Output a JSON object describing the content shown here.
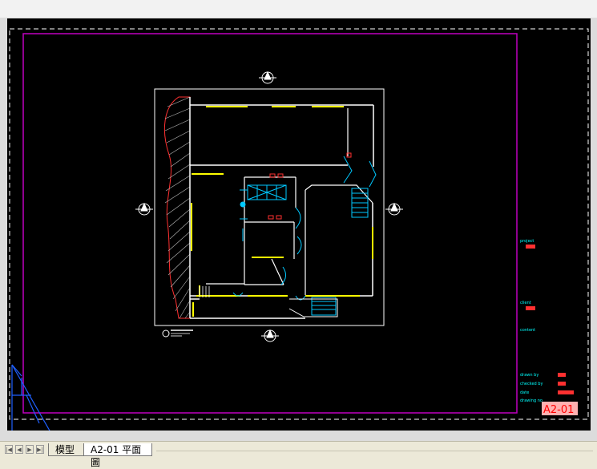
{
  "window": {
    "canvas_bg": "#000000",
    "sheet_border_color": "#c000c0",
    "dash_color": "#ffffff"
  },
  "layout_tabs": {
    "model_label": "模型",
    "layout_label": "A2-01 平面圖"
  },
  "title_block": {
    "project_label": "project",
    "client_label": "client",
    "content_label": "content",
    "drawn_by_label": "drawn by",
    "checked_by_label": "checked by",
    "date_label": "date",
    "drawing_no_label": "drawing no",
    "sheet_number": "A2-01"
  },
  "icons": {
    "nav_first": "first-tab-icon",
    "nav_prev": "previous-tab-icon",
    "nav_next": "next-tab-icon",
    "nav_last": "last-tab-icon",
    "ucs": "ucs-icon",
    "north_arrow": "north-arrow-icon"
  }
}
